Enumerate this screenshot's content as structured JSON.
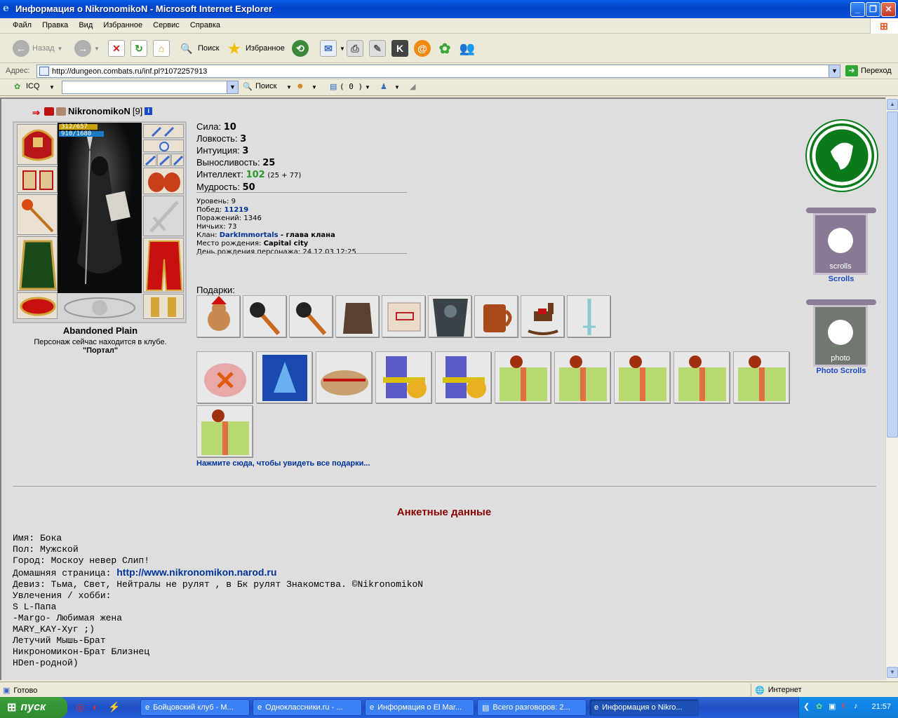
{
  "window": {
    "title": "Информация о NikronomikoN - Microsoft Internet Explorer"
  },
  "menu": [
    "Файл",
    "Правка",
    "Вид",
    "Избранное",
    "Сервис",
    "Справка"
  ],
  "toolbar": {
    "back": "Назад",
    "search": "Поиск",
    "favorites": "Избранное"
  },
  "address": {
    "label": "Адрес:",
    "url": "http://dungeon.combats.ru/inf.pl?1072257913",
    "go": "Переход"
  },
  "icq": {
    "label": "ICQ",
    "search": "Поиск",
    "count": "( 0 )"
  },
  "character": {
    "name": "NikronomikoN",
    "level": "[9]",
    "hp": "312/657",
    "mana": "910/1680",
    "hp_fraction": 0.47,
    "mana_fraction": 0.54,
    "location": "Abandoned Plain",
    "club_text": "Персонаж сейчас находится в клубе.",
    "club_name": "\"Портал\""
  },
  "stats": [
    {
      "label": "Сила:",
      "value": "10"
    },
    {
      "label": "Ловкость:",
      "value": "3"
    },
    {
      "label": "Интуиция:",
      "value": "3"
    },
    {
      "label": "Выносливость:",
      "value": "25"
    },
    {
      "label": "Интеллект:",
      "value": "102",
      "extra": "(25 + 77)"
    },
    {
      "label": "Мудрость:",
      "value": "50"
    }
  ],
  "details": {
    "level": "Уровень: 9",
    "wins_label": "Побед:",
    "wins": "11219",
    "losses": "Поражений: 1346",
    "draws": "Ничьих: 73",
    "clan_label": "Клан:",
    "clan": "DarkImmortals",
    "clan_role": "- глава клана",
    "birthplace_label": "Место рождения:",
    "birthplace": "Capital city",
    "birthday": "День рождения персонажа: 24.12.03 12:25"
  },
  "gifts": {
    "label": "Подарки:",
    "more": "Нажмите сюда, чтобы увидеть все подарки..."
  },
  "side": {
    "scrolls": "Scrolls",
    "photo_scrolls": "Photo Scrolls",
    "scrolls_art": "scrolls",
    "photo_art": "photo"
  },
  "anketa": {
    "title": "Анкетные данные",
    "name": "Имя: Бока",
    "gender": "Пол: Мужской",
    "city": "Город: Москоу невер Слип!",
    "homepage_label": "Домашняя страница: ",
    "homepage": "http://www.nikronomikon.narod.ru",
    "motto": "Девиз: Тьма, Свет, Нейтралы не рулят , в Бк рулят Знакомства. ©NikronomikoN",
    "hobby_label": "Увлечения / хобби:",
    "hobby_lines": [
      "S L-Папа",
      "-Margo- Любимая жена",
      "MARY_KAY-Хуг ;)",
      "Летучий Мышь-Брат",
      "Никрономикон-Брат Близнец",
      "HDen-родной)"
    ]
  },
  "status": {
    "text": "Готово",
    "zone": "Интернет"
  },
  "taskbar": {
    "start": "пуск",
    "tasks": [
      "Бойцовский клуб - М...",
      "Одноклассники.ru - ...",
      "Информация о El Mar...",
      "Всего разговоров: 2...",
      "Информация о Nikro..."
    ],
    "clock": "21:57"
  }
}
